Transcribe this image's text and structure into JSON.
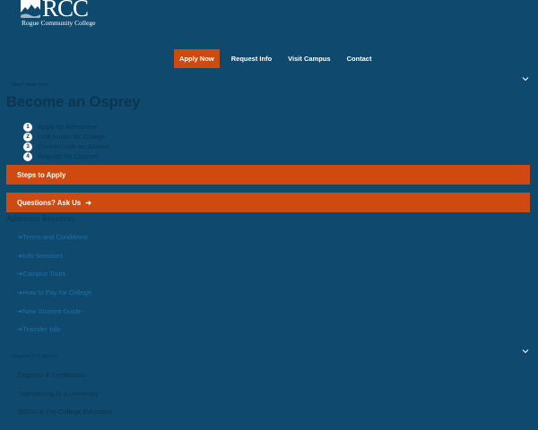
{
  "logo": {
    "letters": "RCC",
    "college_name": "Rogue Community College"
  },
  "nav": {
    "apply": "Apply Now",
    "request_info": "Request Info",
    "visit_campus": "Visit Campus",
    "contact": "Contact"
  },
  "sections": {
    "new": "New? Start Here",
    "degrees": "Degrees & Programs"
  },
  "page_title": "Become an Osprey",
  "steps": [
    {
      "num": "1",
      "label": "Apply for Admission"
    },
    {
      "num": "2",
      "label": "Find Funds for College"
    },
    {
      "num": "3",
      "label": "Connect with an Adviser"
    },
    {
      "num": "4",
      "label": "Register for Courses"
    }
  ],
  "buttons": {
    "steps_to_apply": "Steps to Apply",
    "questions": "Questions? Ask Us",
    "arrow": "➜"
  },
  "resources_heading": "Admission Resources",
  "resources": [
    "Terms and Conditions",
    "Info Sessions",
    "Campus Tours",
    "How to Pay for College",
    "New Student Guide",
    "Transfer Info"
  ],
  "programs": [
    "Degrees & Certificates",
    "Transferring to a University",
    "GED® & Pre-College Education"
  ],
  "colors": {
    "background": "#0f4a6e",
    "accent": "#cf4a0f",
    "text": "#0c3550",
    "link": "#1e6fa8"
  }
}
